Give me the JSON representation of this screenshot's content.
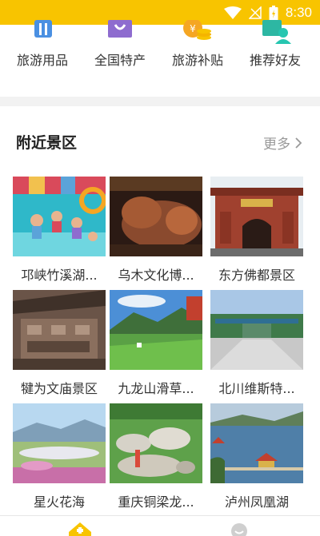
{
  "status_bar": {
    "time": "8:30"
  },
  "quick_entries": [
    {
      "label": "旅游用品",
      "icon": "luggage-icon"
    },
    {
      "label": "全国特产",
      "icon": "specialty-bag-icon"
    },
    {
      "label": "旅游补贴",
      "icon": "subsidy-coin-icon"
    },
    {
      "label": "推荐好友",
      "icon": "recommend-friend-icon"
    }
  ],
  "section": {
    "title": "附近景区",
    "more": "更多"
  },
  "scenic_spots": [
    {
      "name": "邛峡竹溪湖..."
    },
    {
      "name": "乌木文化博..."
    },
    {
      "name": "东方佛都景区"
    },
    {
      "name": "犍为文庙景区"
    },
    {
      "name": "九龙山滑草..."
    },
    {
      "name": "北川维斯特..."
    },
    {
      "name": "星火花海"
    },
    {
      "name": "重庆铜梁龙..."
    },
    {
      "name": "泸州凤凰湖"
    }
  ],
  "colors": {
    "accent": "#f8c400",
    "text": "#333333",
    "muted": "#999999"
  }
}
